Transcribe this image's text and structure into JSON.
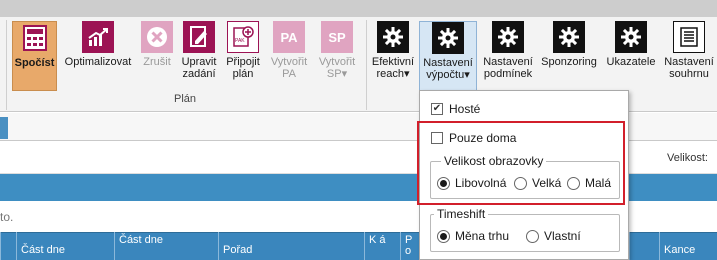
{
  "ribbon": {
    "buttons": {
      "spocist": "Spočíst",
      "optimalizovat": "Optimalizovat",
      "zrusit": "Zrušit",
      "upravit": [
        "Upravit",
        "zadání"
      ],
      "pripojit": [
        "Připojit",
        "plán"
      ],
      "vytvorit_pa": [
        "Vytvořit",
        "PA"
      ],
      "vytvorit_sp": [
        "Vytvořit",
        "SP▾"
      ],
      "efektivni": [
        "Efektivní",
        "reach▾"
      ],
      "nastaveni_vypoctu": [
        "Nastavení",
        "výpočtu▾"
      ],
      "nastaveni_podminek": [
        "Nastavení",
        "podmínek"
      ],
      "sponzoring": "Sponzoring",
      "ukazatele": "Ukazatele",
      "nastaveni_souhrnu": [
        "Nastavení",
        "souhrnu"
      ]
    },
    "icon_text": {
      "pa": "PA",
      "sp": "SP"
    },
    "group_label": "Plán"
  },
  "info": {
    "velikost_label": "Velikost:",
    "to_text": "to."
  },
  "grid": {
    "columns": [
      "",
      "Část dne",
      "Část dne",
      "Pořad",
      "K á",
      "P o",
      "",
      "",
      "",
      "",
      "",
      "Kance"
    ]
  },
  "dropdown": {
    "hoste": {
      "label": "Hosté",
      "checked": true
    },
    "pouze_doma": {
      "label": "Pouze doma",
      "checked": false
    },
    "velikost": {
      "legend": "Velikost obrazovky",
      "options": [
        "Libovolná",
        "Velká",
        "Malá"
      ],
      "selected": "Libovolná"
    },
    "timeshift": {
      "legend": "Timeshift",
      "options": [
        "Měna trhu",
        "Vlastní"
      ],
      "selected": "Měna trhu"
    }
  },
  "colors": {
    "accent_maroon": "#9c1354",
    "highlight_red": "#d21f2b",
    "grid_blue": "#3a86bd"
  }
}
